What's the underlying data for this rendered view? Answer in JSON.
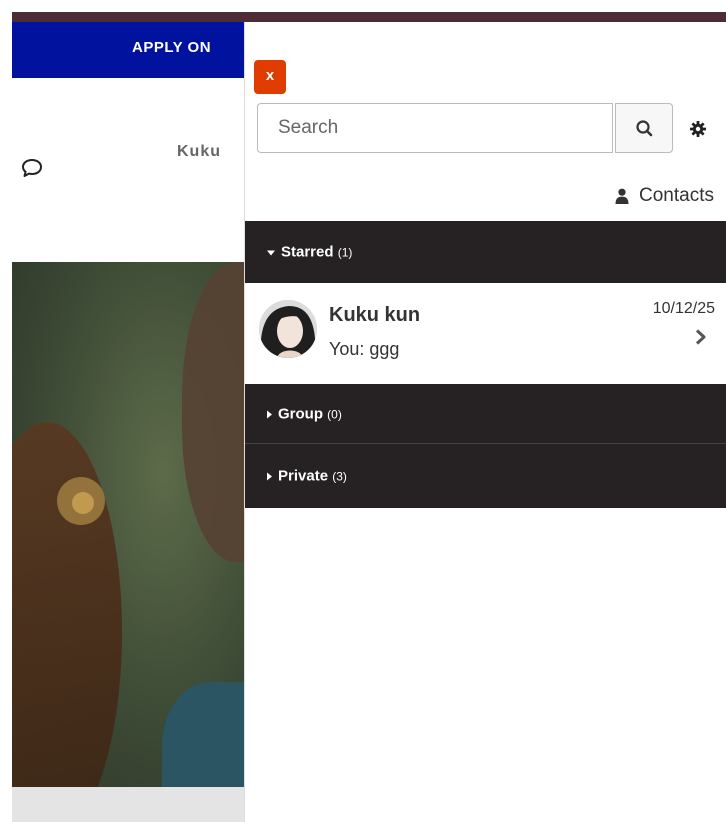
{
  "background_page": {
    "banner_text": "APPLY ON",
    "name_text": "Kuku",
    "icons": {
      "chat": "chat-bubble-icon"
    }
  },
  "panel": {
    "close_label": "x",
    "search": {
      "placeholder": "Search",
      "value": ""
    },
    "icons": {
      "search": "search-icon",
      "settings": "gear-icon",
      "contacts": "user-icon",
      "chevron": "chevron-right-icon"
    },
    "contacts_label": "Contacts",
    "sections": {
      "starred": {
        "label": "Starred",
        "count": "(1)",
        "expanded": true
      },
      "group": {
        "label": "Group",
        "count": "(0)",
        "expanded": false
      },
      "private": {
        "label": "Private",
        "count": "(3)",
        "expanded": false
      }
    },
    "conversations": [
      {
        "name": "Kuku kun",
        "preview": "You: ggg",
        "date": "10/12/25"
      }
    ]
  },
  "colors": {
    "close_button": "#e03b00",
    "section_bg": "#262224",
    "banner_bg": "#00129e",
    "top_stripe": "#4e2c37"
  }
}
